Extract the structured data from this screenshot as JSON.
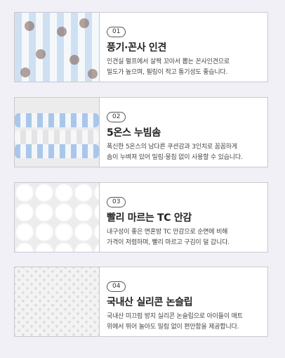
{
  "features": [
    {
      "number": "01",
      "title": "풍기·꼰사 인견",
      "desc_line1": "인견실 펄프에서 살짝 꼬아서 뽑는 꼰사인견으로",
      "desc_line2": "밀도가 높으며, 필링이 적고 통기성도 좋습니다."
    },
    {
      "number": "02",
      "title": "5온스 누빔솜",
      "desc_line1": "폭신한 5온스의 남다른 쿠션감과 3인치로 꼼꼼하게",
      "desc_line2": "솜이 누벼져 있어 밀림·뭉침 없이 사용할 수 있습니다."
    },
    {
      "number": "03",
      "title": "빨리 마르는 TC 안감",
      "desc_line1": "내구성이 좋은 면혼방 TC 안감으로 순면에 비해",
      "desc_line2": "가격이 저렴하며, 빨리 마르고 구김이 덜 갑니다."
    },
    {
      "number": "04",
      "title": "국내산 실리콘 논슬립",
      "desc_line1": "국내산 미끄럼 방지 실리콘 논슬립으로 아이들이 매트",
      "desc_line2": "위에서 뛰어 놀아도 밀림 없이 편안함을 제공합니다."
    }
  ]
}
